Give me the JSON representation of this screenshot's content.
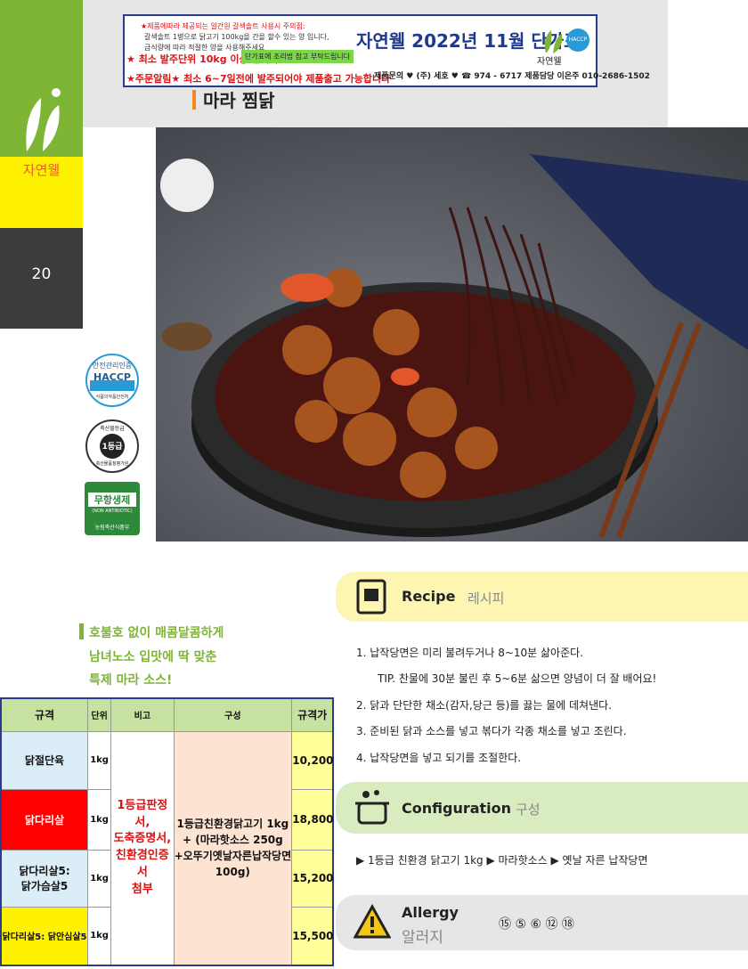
{
  "sidebar": {
    "brand": "자연웰",
    "page_number": "20"
  },
  "header": {
    "notices": [
      "★제품에따라 제공되는 일간원 갈색솔트 사용시 주의점:",
      "갈색솔트 1병으로 닭고기 100kg을 간을 할수 있는 양 입니다,",
      "급식량에 따라 적절한 양을 사용해주세요"
    ],
    "min_order": "★ 최소 발주단위 10kg 이상 입니다",
    "green_note": "단가표에 조리법 참고 부탁드립니다",
    "lead_time": "★주문알림★ 최소 6~7일전에 발주되어야 제품출고 가능합니다",
    "title": "자연웰 2022년 11월 단가표",
    "logo_text": "자연웰",
    "haccp": "HACCP",
    "contact": "제품문의 ♥ (주) 세호 ♥ ☎ 974 - 6717  제품담당 이은주 010-2686-1502"
  },
  "product": {
    "title": "마라 찜닭"
  },
  "certs": {
    "haccp": {
      "top": "안전관리인증",
      "main": "HACCP",
      "bottom": "식품의약품안전처"
    },
    "grade": {
      "top": "축산물등급",
      "main": "1등급",
      "bottom": "축산물품질평가원"
    },
    "antibiotic": {
      "main": "무항생제",
      "sub": "(NON ANTIBIOTIC)",
      "bottom": "농림축산식품부"
    }
  },
  "slogan": [
    "호불호 없이 매콤달콤하게",
    "남녀노소 입맛에 딱 맞춘",
    "특제 마라 소스!"
  ],
  "table": {
    "headers": [
      "규격",
      "단위",
      "비고",
      "구성",
      "규격가"
    ],
    "rows": [
      {
        "name": "닭절단육",
        "unit": "1kg",
        "price": "10,200"
      },
      {
        "name": "닭다리살",
        "unit": "1kg",
        "price": "18,800"
      },
      {
        "name": "닭다리살5:\n닭가슴살5",
        "unit": "1kg",
        "price": "15,200"
      },
      {
        "name": "닭다리살5: 닭안심살5",
        "unit": "1kg",
        "price": "15,500"
      }
    ],
    "remark": "1등급판정서,\n도축증명서,\n친환경인증서\n첨부",
    "composition": "1등급친환경닭고기 1kg\n+ (마라핫소스 250g\n+오뚜기옛날자른납작당면\n100g)"
  },
  "recipe": {
    "en": "Recipe",
    "ko": "레시피",
    "steps": [
      "1.  납작당면은 미리 불려두거나 8~10분 삶아준다.",
      "TIP. 찬물에 30분 불린 후 5~6분 삶으면 양념이 더 잘 배어요!",
      "2.  닭과 단단한 채소(감자,당근 등)를 끓는 물에 데쳐낸다.",
      "3.  준비된 닭과 소스를 넣고 볶다가 각종 채소를 넣고 조린다.",
      "4.  납작당면을 넣고 되기를 조절한다."
    ]
  },
  "configuration": {
    "en": "Configuration",
    "ko": "구성",
    "items": "▶ 1등급 친환경 닭고기 1kg    ▶ 마라핫소스    ▶ 옛날 자른 납작당면"
  },
  "allergy": {
    "en": "Allergy",
    "ko": "알러지",
    "codes": "⑮ ⑤ ⑥ ⑫ ⑱"
  },
  "colors": {
    "green": "#7fb534",
    "yellow": "#fff200",
    "navy": "#2b3c8e",
    "orange": "#f08a1e",
    "red": "#d11111"
  }
}
